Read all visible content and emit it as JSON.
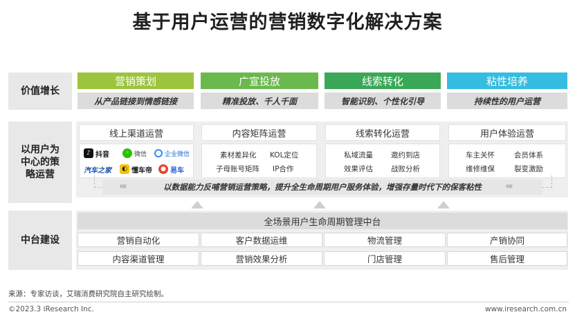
{
  "title": "基于用户运营的营销数字化解决方案",
  "rows": {
    "value_growth": "价值增长",
    "strategy": "以用户为中心的策略运营",
    "platform": "中台建设"
  },
  "pillars": [
    {
      "name": "营销策划",
      "sub": "从产品链接到情感链接",
      "color": "#9cc43d"
    },
    {
      "name": "广宣投放",
      "sub": "精准投放、千人千面",
      "color": "#6bb94e"
    },
    {
      "name": "线索转化",
      "sub": "智能识别、个性化引导",
      "color": "#3aa856"
    },
    {
      "name": "粘性培养",
      "sub": "持续性的用户运营",
      "color": "#34bde0"
    }
  ],
  "strategy": {
    "channel": {
      "title": "线上渠道运营",
      "logos": [
        "抖音",
        "微信",
        "企业微信",
        "汽车之家",
        "懂车帝",
        "易车"
      ]
    },
    "content": {
      "title": "内容矩阵运营",
      "items": [
        "素材差异化",
        "KOL定位",
        "子母账号矩阵",
        "IP合作"
      ]
    },
    "lead": {
      "title": "线索转化运营",
      "items": [
        "私域流量",
        "邀约到店",
        "效果评估",
        "战败分析"
      ]
    },
    "experience": {
      "title": "用户体验运营",
      "items": [
        "车主关怀",
        "会员体系",
        "维修维保",
        "裂变激励"
      ]
    },
    "banner": "以数据能力反哺营销运营策略，提升全生命周期用户服务体验，增强存量时代下的保客粘性"
  },
  "platform": {
    "title": "全场景用户生命周期管理中台",
    "items": [
      "营销自动化",
      "客户数据运维",
      "物流管理",
      "产销协同",
      "内容渠道管理",
      "营销效果分析",
      "门店管理",
      "售后管理"
    ]
  },
  "footer": {
    "source": "来源：专家访谈，艾瑞消费研究院自主研究绘制。",
    "copyright": "©2023.3 iResearch Inc.",
    "website": "www.iresearch.com.cn"
  }
}
